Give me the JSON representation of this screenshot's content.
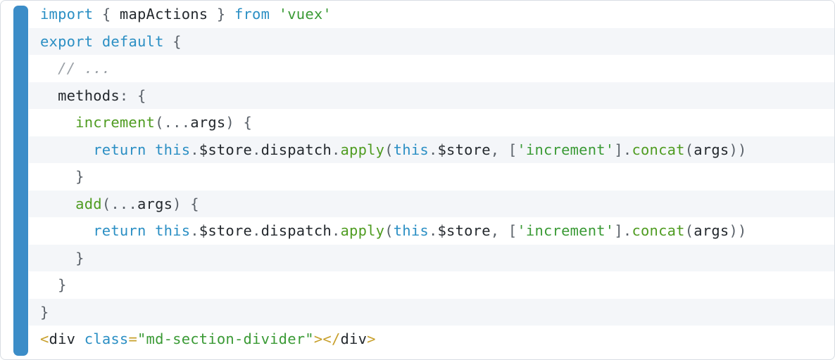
{
  "code_block": {
    "language": "javascript",
    "accent_color": "#3c8dc8",
    "border_color": "#d8dde3",
    "stripe_color": "#f4f6f9",
    "background_color": "#ffffff",
    "token_colors": {
      "keyword": "#2b8fc4",
      "function": "#4f9c21",
      "string": "#3a9a35",
      "comment": "#9aa0a6",
      "punctuation": "#5a6169",
      "plain": "#24292e",
      "tag_bracket": "#c8a02c",
      "attribute": "#2b8fc4"
    },
    "lines": [
      {
        "n": 1,
        "text": "import { mapActions } from 'vuex'",
        "tokens": [
          {
            "t": "import",
            "c": "kw"
          },
          {
            "t": " ",
            "c": "plain"
          },
          {
            "t": "{",
            "c": "punc"
          },
          {
            "t": " ",
            "c": "plain"
          },
          {
            "t": "mapActions",
            "c": "plain"
          },
          {
            "t": " ",
            "c": "plain"
          },
          {
            "t": "}",
            "c": "punc"
          },
          {
            "t": " ",
            "c": "plain"
          },
          {
            "t": "from",
            "c": "kw"
          },
          {
            "t": " ",
            "c": "plain"
          },
          {
            "t": "'vuex'",
            "c": "str"
          }
        ]
      },
      {
        "n": 2,
        "text": "export default {",
        "tokens": [
          {
            "t": "export",
            "c": "kw"
          },
          {
            "t": " ",
            "c": "plain"
          },
          {
            "t": "default",
            "c": "kw"
          },
          {
            "t": " ",
            "c": "plain"
          },
          {
            "t": "{",
            "c": "punc"
          }
        ]
      },
      {
        "n": 3,
        "text": "  // ...",
        "tokens": [
          {
            "t": "  ",
            "c": "plain"
          },
          {
            "t": "// ...",
            "c": "com"
          }
        ]
      },
      {
        "n": 4,
        "text": "  methods: {",
        "tokens": [
          {
            "t": "  ",
            "c": "plain"
          },
          {
            "t": "methods",
            "c": "plain"
          },
          {
            "t": ":",
            "c": "punc"
          },
          {
            "t": " ",
            "c": "plain"
          },
          {
            "t": "{",
            "c": "punc"
          }
        ]
      },
      {
        "n": 5,
        "text": "    increment(...args) {",
        "tokens": [
          {
            "t": "    ",
            "c": "plain"
          },
          {
            "t": "increment",
            "c": "fn"
          },
          {
            "t": "(",
            "c": "punc"
          },
          {
            "t": "...",
            "c": "punc"
          },
          {
            "t": "args",
            "c": "plain"
          },
          {
            "t": ")",
            "c": "punc"
          },
          {
            "t": " ",
            "c": "plain"
          },
          {
            "t": "{",
            "c": "punc"
          }
        ]
      },
      {
        "n": 6,
        "text": "      return this.$store.dispatch.apply(this.$store, ['increment'].concat(args))",
        "truncated": true,
        "tokens": [
          {
            "t": "      ",
            "c": "plain"
          },
          {
            "t": "return",
            "c": "kw"
          },
          {
            "t": " ",
            "c": "plain"
          },
          {
            "t": "this",
            "c": "kw"
          },
          {
            "t": ".",
            "c": "punc"
          },
          {
            "t": "$store",
            "c": "plain"
          },
          {
            "t": ".",
            "c": "punc"
          },
          {
            "t": "dispatch",
            "c": "plain"
          },
          {
            "t": ".",
            "c": "punc"
          },
          {
            "t": "apply",
            "c": "fn"
          },
          {
            "t": "(",
            "c": "punc"
          },
          {
            "t": "this",
            "c": "kw"
          },
          {
            "t": ".",
            "c": "punc"
          },
          {
            "t": "$store",
            "c": "plain"
          },
          {
            "t": ",",
            "c": "punc"
          },
          {
            "t": " ",
            "c": "plain"
          },
          {
            "t": "[",
            "c": "punc"
          },
          {
            "t": "'increment'",
            "c": "str"
          },
          {
            "t": "]",
            "c": "punc"
          },
          {
            "t": ".",
            "c": "punc"
          },
          {
            "t": "concat",
            "c": "fn"
          },
          {
            "t": "(",
            "c": "punc"
          },
          {
            "t": "args",
            "c": "plain"
          },
          {
            "t": ")",
            "c": "punc"
          },
          {
            "t": ")",
            "c": "punc"
          }
        ]
      },
      {
        "n": 7,
        "text": "    }",
        "tokens": [
          {
            "t": "    ",
            "c": "plain"
          },
          {
            "t": "}",
            "c": "punc"
          }
        ]
      },
      {
        "n": 8,
        "text": "    add(...args) {",
        "tokens": [
          {
            "t": "    ",
            "c": "plain"
          },
          {
            "t": "add",
            "c": "fn"
          },
          {
            "t": "(",
            "c": "punc"
          },
          {
            "t": "...",
            "c": "punc"
          },
          {
            "t": "args",
            "c": "plain"
          },
          {
            "t": ")",
            "c": "punc"
          },
          {
            "t": " ",
            "c": "plain"
          },
          {
            "t": "{",
            "c": "punc"
          }
        ]
      },
      {
        "n": 9,
        "text": "      return this.$store.dispatch.apply(this.$store, ['increment'].concat(args))",
        "truncated": true,
        "tokens": [
          {
            "t": "      ",
            "c": "plain"
          },
          {
            "t": "return",
            "c": "kw"
          },
          {
            "t": " ",
            "c": "plain"
          },
          {
            "t": "this",
            "c": "kw"
          },
          {
            "t": ".",
            "c": "punc"
          },
          {
            "t": "$store",
            "c": "plain"
          },
          {
            "t": ".",
            "c": "punc"
          },
          {
            "t": "dispatch",
            "c": "plain"
          },
          {
            "t": ".",
            "c": "punc"
          },
          {
            "t": "apply",
            "c": "fn"
          },
          {
            "t": "(",
            "c": "punc"
          },
          {
            "t": "this",
            "c": "kw"
          },
          {
            "t": ".",
            "c": "punc"
          },
          {
            "t": "$store",
            "c": "plain"
          },
          {
            "t": ",",
            "c": "punc"
          },
          {
            "t": " ",
            "c": "plain"
          },
          {
            "t": "[",
            "c": "punc"
          },
          {
            "t": "'increment'",
            "c": "str"
          },
          {
            "t": "]",
            "c": "punc"
          },
          {
            "t": ".",
            "c": "punc"
          },
          {
            "t": "concat",
            "c": "fn"
          },
          {
            "t": "(",
            "c": "punc"
          },
          {
            "t": "args",
            "c": "plain"
          },
          {
            "t": ")",
            "c": "punc"
          },
          {
            "t": ")",
            "c": "punc"
          }
        ]
      },
      {
        "n": 10,
        "text": "    }",
        "tokens": [
          {
            "t": "    ",
            "c": "plain"
          },
          {
            "t": "}",
            "c": "punc"
          }
        ]
      },
      {
        "n": 11,
        "text": "  }",
        "tokens": [
          {
            "t": "  ",
            "c": "plain"
          },
          {
            "t": "}",
            "c": "punc"
          }
        ]
      },
      {
        "n": 12,
        "text": "}",
        "tokens": [
          {
            "t": "}",
            "c": "punc"
          }
        ]
      },
      {
        "n": 13,
        "text": "<div class=\"md-section-divider\"></div>",
        "tokens": [
          {
            "t": "<",
            "c": "tag"
          },
          {
            "t": "div",
            "c": "tagname"
          },
          {
            "t": " ",
            "c": "plain"
          },
          {
            "t": "class",
            "c": "attr"
          },
          {
            "t": "=",
            "c": "tag"
          },
          {
            "t": "\"md-section-divider\"",
            "c": "str"
          },
          {
            "t": ">",
            "c": "tag"
          },
          {
            "t": "<",
            "c": "tag"
          },
          {
            "t": "/",
            "c": "tag"
          },
          {
            "t": "div",
            "c": "tagname"
          },
          {
            "t": ">",
            "c": "tag"
          }
        ]
      }
    ]
  }
}
